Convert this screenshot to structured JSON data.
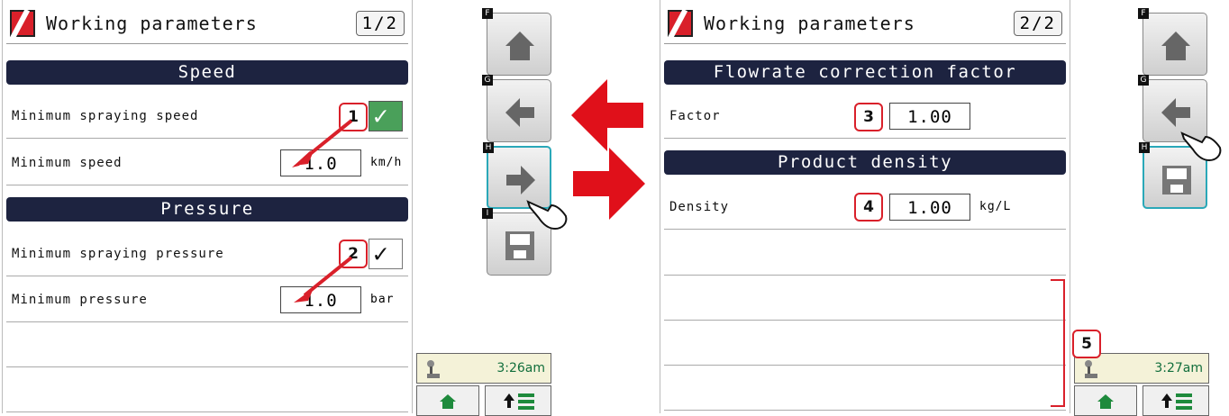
{
  "left": {
    "title": "Working parameters",
    "page": "1/2",
    "sections": {
      "speed": "Speed",
      "pressure": "Pressure"
    },
    "rows": {
      "min_spraying_speed": "Minimum spraying speed",
      "min_speed": "Minimum speed",
      "min_speed_value": "1.0",
      "min_speed_unit": "km/h",
      "min_spraying_pressure": "Minimum spraying pressure",
      "min_pressure": "Minimum pressure",
      "min_pressure_value": "1.0",
      "min_pressure_unit": "bar"
    },
    "side_keys": [
      "F",
      "G",
      "H",
      "I"
    ],
    "time": "3:26am"
  },
  "right": {
    "title": "Working parameters",
    "page": "2/2",
    "sections": {
      "flowrate": "Flowrate correction factor",
      "density": "Product density"
    },
    "rows": {
      "factor": "Factor",
      "factor_value": "1.00",
      "density": "Density",
      "density_value": "1.00",
      "density_unit": "kg/L"
    },
    "side_keys": [
      "F",
      "G",
      "H"
    ],
    "time": "3:27am"
  },
  "callouts": [
    "1",
    "2",
    "3",
    "4",
    "5"
  ],
  "colors": {
    "accent_red": "#d9202a",
    "header_navy": "#1d2340",
    "check_green": "#4aa05a",
    "active_teal": "#2aa8b8"
  }
}
